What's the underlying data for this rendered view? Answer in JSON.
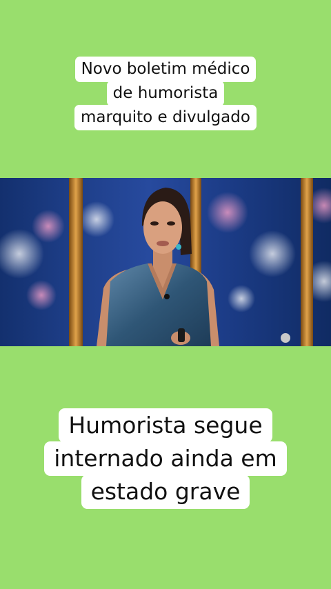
{
  "top_caption": {
    "lines": [
      "Novo boletim médico",
      "de humorista",
      "marquito e divulgado"
    ]
  },
  "video": {
    "description_icon": "news-anchor-image"
  },
  "bottom_caption": {
    "lines": [
      "Humorista segue",
      "internado ainda em",
      "estado grave"
    ]
  },
  "colors": {
    "background": "#99DE6D",
    "caption_bg": "#FFFFFF",
    "text": "#111111"
  }
}
